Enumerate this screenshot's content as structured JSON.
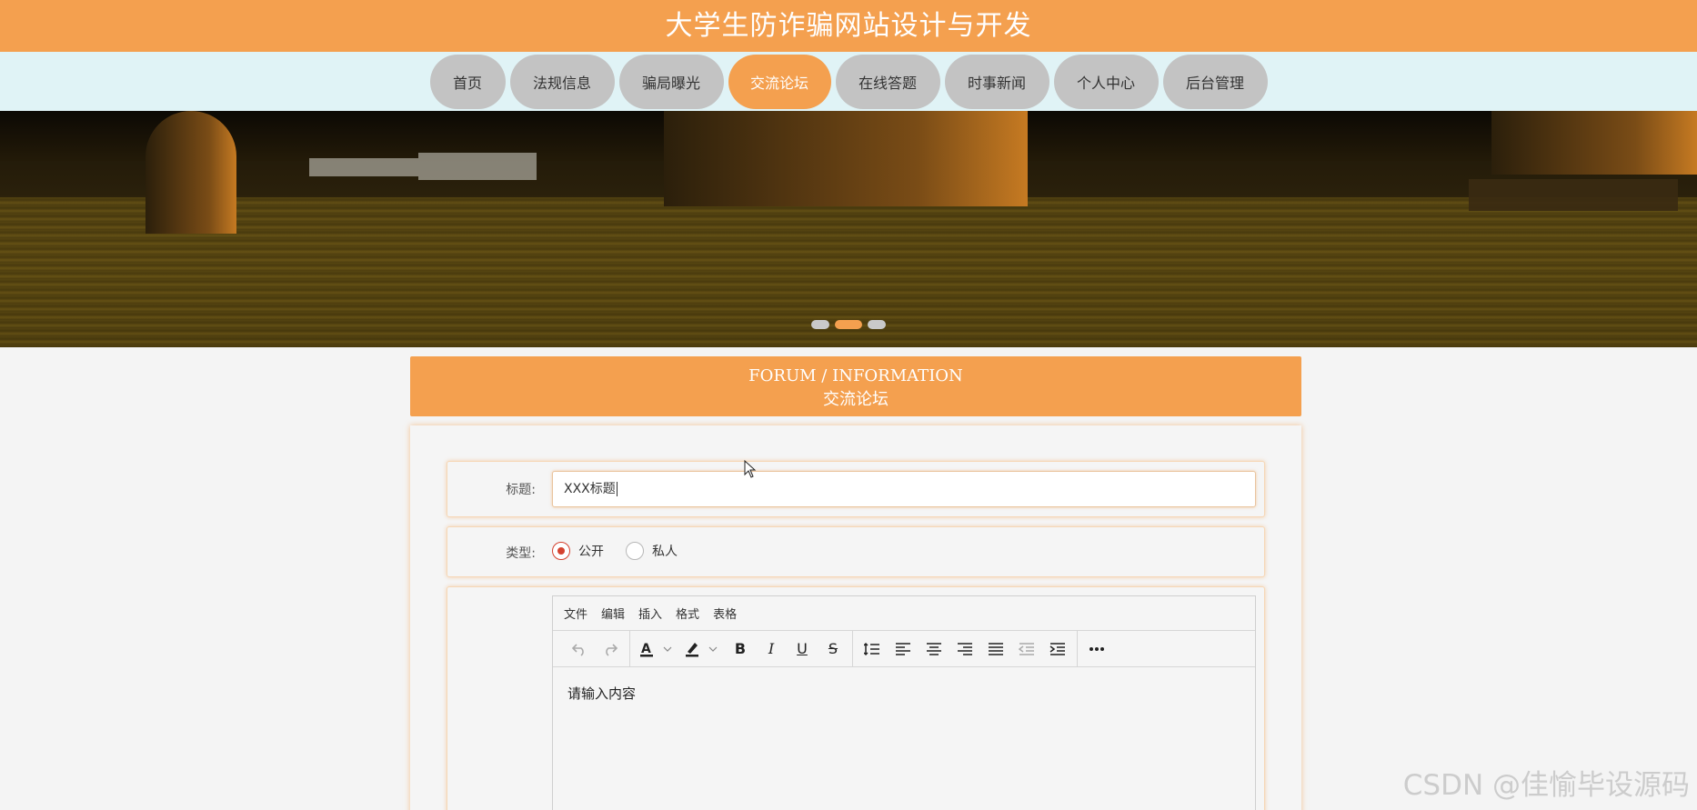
{
  "header": {
    "title": "大学生防诈骗网站设计与开发"
  },
  "nav": {
    "items": [
      {
        "label": "首页",
        "active": false
      },
      {
        "label": "法规信息",
        "active": false
      },
      {
        "label": "骗局曝光",
        "active": false
      },
      {
        "label": "交流论坛",
        "active": true
      },
      {
        "label": "在线答题",
        "active": false
      },
      {
        "label": "时事新闻",
        "active": false
      },
      {
        "label": "个人中心",
        "active": false
      },
      {
        "label": "后台管理",
        "active": false
      }
    ]
  },
  "banner": {
    "slides": 3,
    "active_slide": 2
  },
  "section": {
    "title_en": "FORUM / INFORMATION",
    "title_cn": "交流论坛"
  },
  "form": {
    "title_label": "标题:",
    "title_value": "XXX标题",
    "type_label": "类型:",
    "type_options": [
      {
        "label": "公开",
        "checked": true
      },
      {
        "label": "私人",
        "checked": false
      }
    ],
    "editor": {
      "menu": [
        "文件",
        "编辑",
        "插入",
        "格式",
        "表格"
      ],
      "placeholder": "请输入内容"
    }
  },
  "watermark": "CSDN @佳愉毕设源码",
  "colors": {
    "accent": "#f4a04f",
    "nav_bg": "#e0f3f6",
    "nav_item": "#c3c3c3",
    "radio_checked": "#d4422f"
  }
}
